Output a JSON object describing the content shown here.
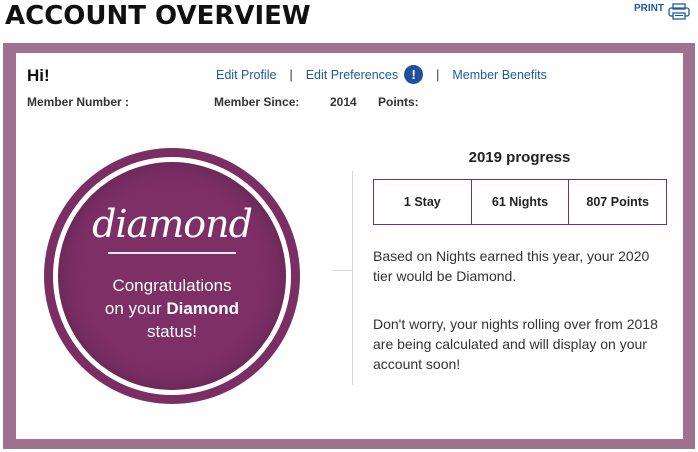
{
  "header": {
    "title": "ACCOUNT OVERVIEW",
    "print_label": "PRINT",
    "print_icon": "printer-icon"
  },
  "colors": {
    "frame": "#a0718f",
    "badge": "#7d2f66",
    "link": "#1e5aa6",
    "alert": "#1e4fa0"
  },
  "greeting": "Hi!",
  "links": {
    "edit_profile": "Edit Profile",
    "edit_preferences": "Edit Preferences",
    "alert_icon": "!",
    "member_benefits": "Member Benefits",
    "separator": "|"
  },
  "member": {
    "number_label": "Member Number :",
    "number_value": "",
    "since_label": "Member Since:",
    "since_value": "2014",
    "points_label": "Points:",
    "points_value": ""
  },
  "badge": {
    "tier_word": "diamond",
    "congrats_line1": "Congratulations",
    "congrats_line2_prefix": "on your",
    "congrats_tier": "Diamond",
    "congrats_line3": "status!"
  },
  "progress": {
    "title": "2019 progress",
    "cells": [
      "1 Stay",
      "61 Nights",
      "807 Points"
    ],
    "paragraph1": "Based on Nights earned this year, your 2020 tier would be Diamond.",
    "paragraph2": "Don't worry, your nights rolling over from 2018 are being calculated and will display on your account soon!"
  }
}
